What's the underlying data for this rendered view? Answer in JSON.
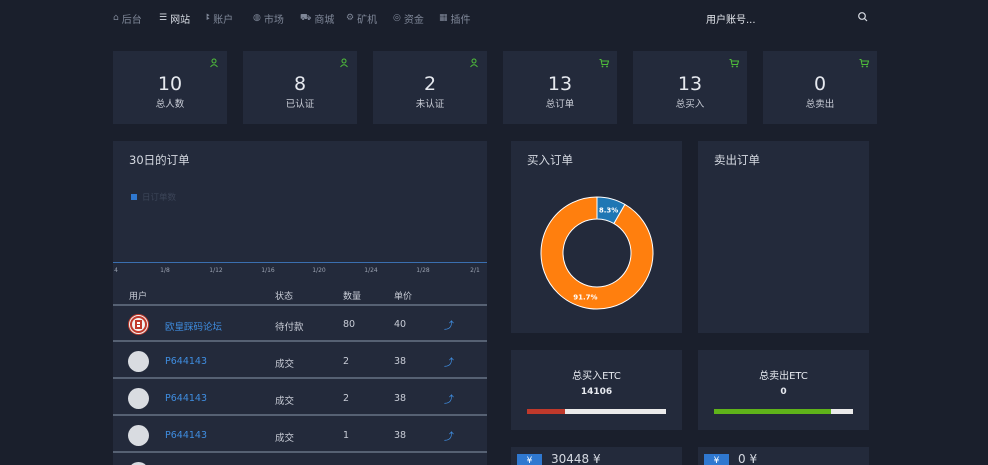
{
  "nav": {
    "items": [
      {
        "label": "后台",
        "icon": "home-icon"
      },
      {
        "label": "网站",
        "icon": "list-icon"
      },
      {
        "label": "账户",
        "icon": "users-icon"
      },
      {
        "label": "市场",
        "icon": "globe-icon"
      },
      {
        "label": "商城",
        "icon": "cart-icon"
      },
      {
        "label": "矿机",
        "icon": "gear-icon"
      },
      {
        "label": "资金",
        "icon": "money-icon"
      },
      {
        "label": "插件",
        "icon": "grid-icon"
      }
    ],
    "user_menu": "用户账号..."
  },
  "stats": [
    {
      "value": "10",
      "label": "总人数",
      "icon": "user-icon"
    },
    {
      "value": "8",
      "label": "已认证",
      "icon": "user-icon"
    },
    {
      "value": "2",
      "label": "未认证",
      "icon": "user-icon"
    },
    {
      "value": "13",
      "label": "总订单",
      "icon": "cart-icon"
    },
    {
      "value": "13",
      "label": "总买入",
      "icon": "cart-icon"
    },
    {
      "value": "0",
      "label": "总卖出",
      "icon": "cart-icon"
    }
  ],
  "orders_panel": {
    "title": "30日的订单",
    "legend": "日订单数",
    "x_ticks": [
      "4",
      "1/8",
      "1/12",
      "1/16",
      "1/20",
      "1/24",
      "1/28",
      "2/1"
    ],
    "columns": [
      "用户",
      "状态",
      "数量",
      "单价"
    ],
    "rows": [
      {
        "user": "欧皇踩码论坛",
        "status": "待付款",
        "qty": "80",
        "price": "40",
        "logo": true
      },
      {
        "user": "P644143",
        "status": "成交",
        "qty": "2",
        "price": "38",
        "logo": false
      },
      {
        "user": "P644143",
        "status": "成交",
        "qty": "2",
        "price": "38",
        "logo": false
      },
      {
        "user": "P644143",
        "status": "成交",
        "qty": "1",
        "price": "38",
        "logo": false
      }
    ]
  },
  "buy_panel": {
    "title": "买入订单"
  },
  "sell_panel": {
    "title": "卖出订单"
  },
  "chart_data": {
    "type": "pie",
    "title": "买入订单",
    "categories": [
      "8.3%",
      "91.7%"
    ],
    "values": [
      8.3,
      91.7
    ],
    "colors": [
      "#1f77b4",
      "#ff7f0e"
    ]
  },
  "summaries": [
    {
      "title": "总买入ETC",
      "value": "14106",
      "fill": 0.27,
      "fill_color": "#c0392b"
    },
    {
      "title": "总卖出ETC",
      "value": "0",
      "fill": 0.84,
      "fill_color": "#5fb31a"
    }
  ],
  "money": [
    {
      "currency": "¥",
      "amount": "30448 ¥"
    },
    {
      "currency": "¥",
      "amount": "0 ¥"
    }
  ],
  "colors": {
    "accent": "#2f78d0",
    "link": "#3f8de0",
    "icon_green": "#4fbf3a"
  }
}
